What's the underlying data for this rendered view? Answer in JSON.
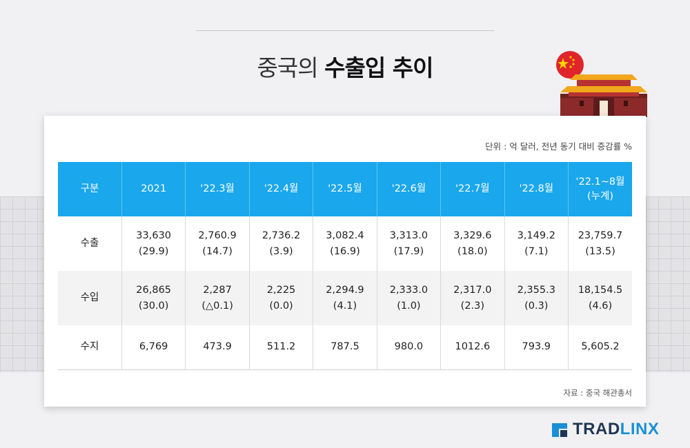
{
  "title": {
    "normal": "중국의",
    "bold": "수출입 추이"
  },
  "unit_note": "단위 : 억 달러, 전년 동기 대비 증감률 %",
  "source_note": "자료 : 중국 해관총서",
  "logo": {
    "part1": "TRAD",
    "part2": "LINX"
  },
  "colors": {
    "header": "#1aa7ec",
    "logo_dark": "#1f3552",
    "logo_blue": "#1a8fd6",
    "flag_red": "#e0242b"
  },
  "chart_data": {
    "type": "table",
    "columns": [
      "구분",
      "2021",
      "'22.3월",
      "'22.4월",
      "'22.5월",
      "'22.6월",
      "'22.7월",
      "'22.8월",
      "'22.1~8월\n(누계)"
    ],
    "rows": [
      {
        "label": "수출",
        "values": [
          "33,630\n(29.9)",
          "2,760.9\n(14.7)",
          "2,736.2\n(3.9)",
          "3,082.4\n(16.9)",
          "3,313.0\n(17.9)",
          "3,329.6\n(18.0)",
          "3,149.2\n(7.1)",
          "23,759.7\n(13.5)"
        ]
      },
      {
        "label": "수입",
        "values": [
          "26,865\n(30.0)",
          "2,287\n(△0.1)",
          "2,225\n(0.0)",
          "2,294.9\n(4.1)",
          "2,333.0\n(1.0)",
          "2,317.0\n(2.3)",
          "2,355.3\n(0.3)",
          "18,154.5\n(4.6)"
        ]
      },
      {
        "label": "수지",
        "values": [
          "6,769",
          "473.9",
          "511.2",
          "787.5",
          "980.0",
          "1012.6",
          "793.9",
          "5,605.2"
        ]
      }
    ]
  }
}
